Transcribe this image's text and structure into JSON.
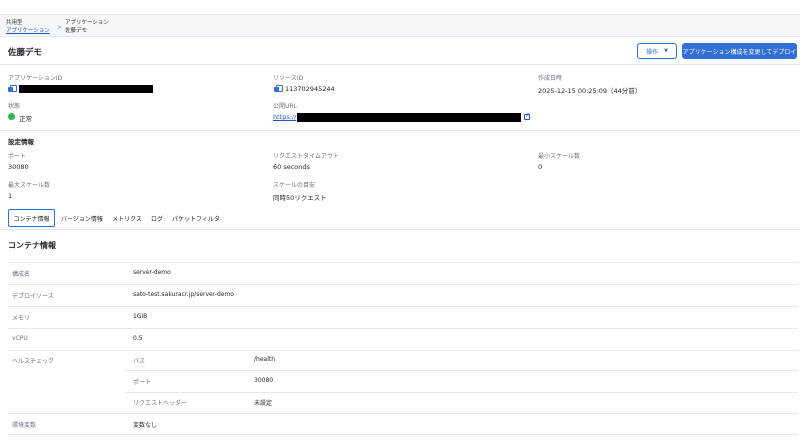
{
  "breadcrumb": {
    "parent_top": "共用型",
    "parent_link": "アプリケーション",
    "current_top": "アプリケーション",
    "current": "佐藤デモ",
    "separator": ">"
  },
  "header": {
    "title": "佐藤デモ",
    "ops_button": "操作",
    "deploy_button": "アプリケーション構成を変更してデプロイ"
  },
  "summary": {
    "app_id_label": "アプリケーションID",
    "resource_id_label": "リソースID",
    "resource_id": "113702945244",
    "created_label": "作成日時",
    "created": "2025-12-15 00:25:09（44分前）",
    "status_label": "状態",
    "status": "正常",
    "public_url_label": "公開URL",
    "public_url_prefix": "https://"
  },
  "settings": {
    "heading": "設定情報",
    "port_label": "ポート",
    "port": "30080",
    "timeout_label": "リクエストタイムアウト",
    "timeout": "60 seconds",
    "min_scale_label": "最小スケール数",
    "min_scale": "0",
    "max_scale_label": "最大スケール数",
    "max_scale": "1",
    "scale_target_label": "スケールの目安",
    "scale_target": "同時50リクエスト"
  },
  "tabs": [
    "コンテナ情報",
    "バージョン情報",
    "メトリクス",
    "ログ",
    "パケットフィルタ"
  ],
  "container": {
    "title": "コンテナ情報",
    "name_label": "構成名",
    "name": "server-demo",
    "source_label": "デプロイソース",
    "source": "sato-test.sakuracr.jp/server-demo",
    "memory_label": "メモリ",
    "memory": "1GiB",
    "vcpu_label": "vCPU",
    "vcpu": "0.5",
    "health_label": "ヘルスチェック",
    "path_label": "パス",
    "path": "/health",
    "hc_port_label": "ポート",
    "hc_port": "30080",
    "header_label": "リクエストヘッダー",
    "header_value": "未設定",
    "env_label": "環境変数",
    "env_value": "変数なし"
  }
}
